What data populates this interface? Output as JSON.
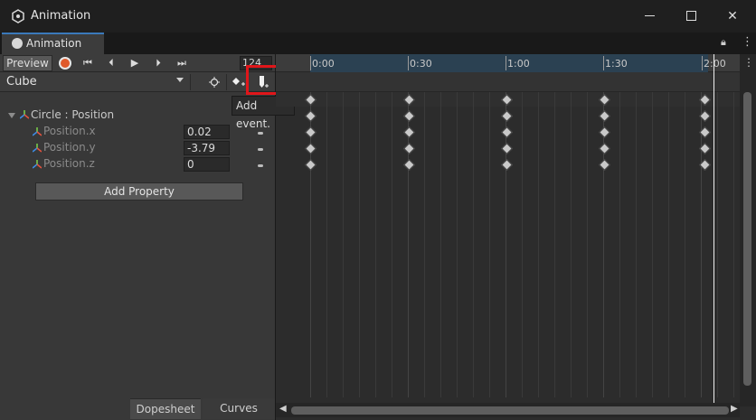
{
  "window": {
    "title": "Animation",
    "minimize_label": "—",
    "maximize_label": "☐",
    "close_label": "✕"
  },
  "tab": {
    "label": "Animation",
    "icon": "clock-icon"
  },
  "toolbar": {
    "preview_label": "Preview",
    "record_icon": "record-icon",
    "first_key": "⏮",
    "prev_key": "⏴",
    "play": "▶",
    "next_key": "⏵",
    "last_key": "⏭",
    "frame_value": "124"
  },
  "clip": {
    "selected": "Cube"
  },
  "tools": {
    "add_keyframe_icon": "add-keyframe-icon",
    "add_event_icon": "add-event-icon",
    "focus_icon": "crosshair-icon"
  },
  "tooltip": {
    "text": "Add event."
  },
  "properties": {
    "group_label": "Circle : Position",
    "items": [
      {
        "name": "Position.x",
        "value": "0.02"
      },
      {
        "name": "Position.y",
        "value": "-3.79"
      },
      {
        "name": "Position.z",
        "value": "0"
      }
    ],
    "add_property_label": "Add Property"
  },
  "timeline": {
    "ticks": [
      "0:00",
      "0:30",
      "1:00",
      "1:30",
      "2:00"
    ]
  },
  "bottom_tabs": {
    "dopesheet": "Dopesheet",
    "curves": "Curves"
  },
  "colors": {
    "accent": "#3a79bb",
    "record": "#e05a2b",
    "highlight": "#e0161a"
  }
}
